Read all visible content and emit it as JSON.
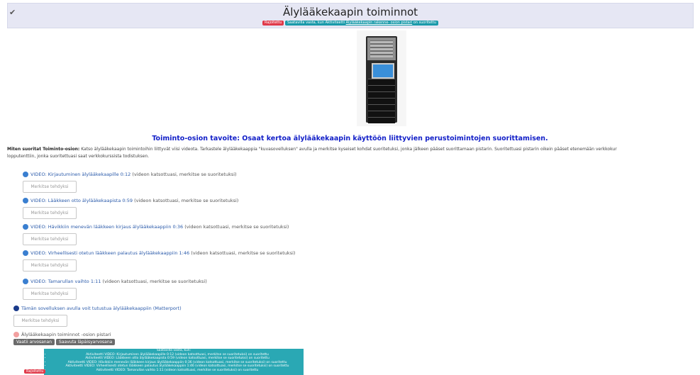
{
  "header": {
    "title": "Älylääkekaapin toiminnot",
    "badges": {
      "required": "Rajoitettu",
      "restriction_prefix": "Saatavilla vasta, kun",
      "restriction_activity": "Aktiviteetti",
      "restriction_link": "Älylääkekaapin rakenne- osion pistari",
      "restriction_suffix": "on suoritettu"
    }
  },
  "goal": "Toiminto-osion tavoite: Osaat kertoa älylääkekaapin käyttöön liittyvien perustoimintojen suorittamisen.",
  "instructions": {
    "lead": "Miten suoritat Toiminto-osion:",
    "text": "Katso älylääkekaapin toimintoihin liittyvät viisi videota. Tarkastele älylääkekaappia \"kuvasovelluksen\" avulla ja merkitse kyseiset kohdat suoritetuksi, jonka jälkeen pääset suorittamaan pistarin. Suoritettuasi pistarin oikein pääset etenemään verkkokur",
    "text2": "lopputenttiin, jonka suoritettuasi saat verkkokurssista todistuksen."
  },
  "activities": [
    {
      "link": "VIDEO: Kirjautuminen älylääkekaapille 0:12",
      "note": "(videon katsottuasi, merkitse se suoritetuksi)",
      "button": "Merkitse tehdyksi"
    },
    {
      "link": "VIDEO: Lääkkeen otto älylääkekaapista 0:59",
      "note": "(videon katsottuasi, merkitse se suoritetuksi)",
      "button": "Merkitse tehdyksi"
    },
    {
      "link": "VIDEO: Hävikkiin menevän lääkkeen kirjaus älylääkekaappiin 0:36",
      "note": "(videon katsottuasi, merkitse se suoritetuksi)",
      "button": "Merkitse tehdyksi"
    },
    {
      "link": "VIDEO: Virheellisesti otetun lääkkeen palautus älylääkekaappiin 1:46",
      "note": "(videon katsottuasi, merkitse se suoritetuksi)",
      "button": "Merkitse tehdyksi"
    },
    {
      "link": "VIDEO: Tamarullan vaihto 1:11",
      "note": "(videon katsottuasi, merkitse se suoritetuksi)",
      "button": "Merkitse tehdyksi"
    }
  ],
  "matterport": {
    "link": "Tämän sovelluksen avulla voit tutustua älylääkekaappiin (Matterport)",
    "button": "Merkitse tehdyksi"
  },
  "quiz": {
    "label": "Älylääkekaapin toiminnot -osion pistari",
    "btn_grade": "Vaatii arvosanan",
    "btn_pass": "Saavuta läpäisyarvosana"
  },
  "restriction_box": {
    "title": "Saatavilla vasta, kun:",
    "items": [
      "Aktiviteetti VIDEO: Kirjautuminen älylääkekaapille 0:12 (videon katsottuasi, merkitse se suoritetuksi) on suoritettu",
      "Aktiviteetti VIDEO: Lääkkeen otto älylääkekaapista 0:59 (videon katsottuasi, merkitse se suoritetuksi) on suoritettu",
      "Aktiviteetti VIDEO: Hävikkiin menevän lääkkeen kirjaus älylääkekaappiin 0:36 (videon katsottuasi, merkitse se suoritetuksi) on suoritettu",
      "Aktiviteetti VIDEO: Virheellisesti otetun lääkkeen palautus älylääkekaappiin 1:46 (videon katsottuasi, merkitse se suoritetuksi) on suoritettu",
      "Aktiviteetti VIDEO: Tamarullan vaihto 1:11 (videon katsottuasi, merkitse se suoritetuksi) on suoritettu"
    ],
    "bottom_badge": "Rajoitettu"
  }
}
